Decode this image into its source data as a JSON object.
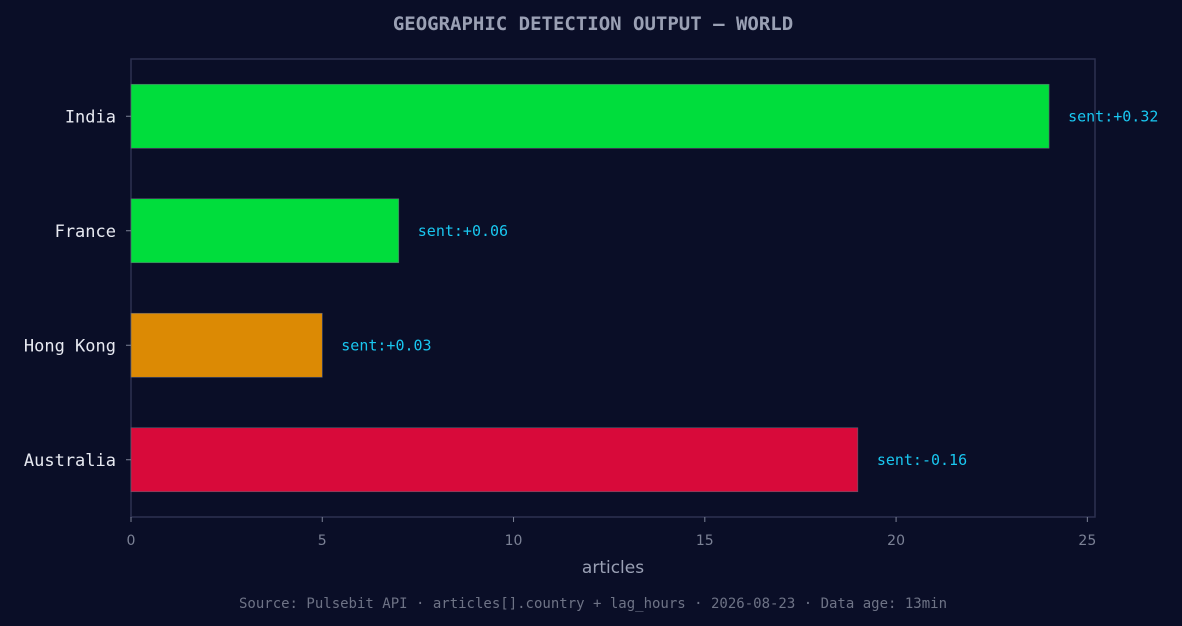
{
  "chart_data": {
    "type": "bar",
    "orientation": "horizontal",
    "title": "GEOGRAPHIC DETECTION OUTPUT — WORLD",
    "xlabel": "articles",
    "ylabel": "",
    "xlim": [
      0,
      25.2
    ],
    "x_ticks": [
      0,
      5,
      10,
      15,
      20,
      25
    ],
    "categories": [
      "India",
      "France",
      "Hong Kong",
      "Australia"
    ],
    "values": [
      24,
      7,
      5,
      19
    ],
    "bar_colors": [
      "#00dd3c",
      "#00dd3c",
      "#dc8a04",
      "#d80a3a"
    ],
    "data_labels": [
      "sent:+0.32",
      "sent:+0.06",
      "sent:+0.03",
      "sent:-0.16"
    ],
    "grid": false,
    "legend": "none"
  },
  "footer": {
    "source": "Source: Pulsebit API · articles[].country + lag_hours · 2026-08-23 · Data age: 13min"
  },
  "colors": {
    "background": "#0a0e27",
    "frame": "#2c3150",
    "title": "#9aa0b4",
    "category_label": "#e8eaf2",
    "tick_label": "#7c8296",
    "data_label": "#19c7f0"
  }
}
